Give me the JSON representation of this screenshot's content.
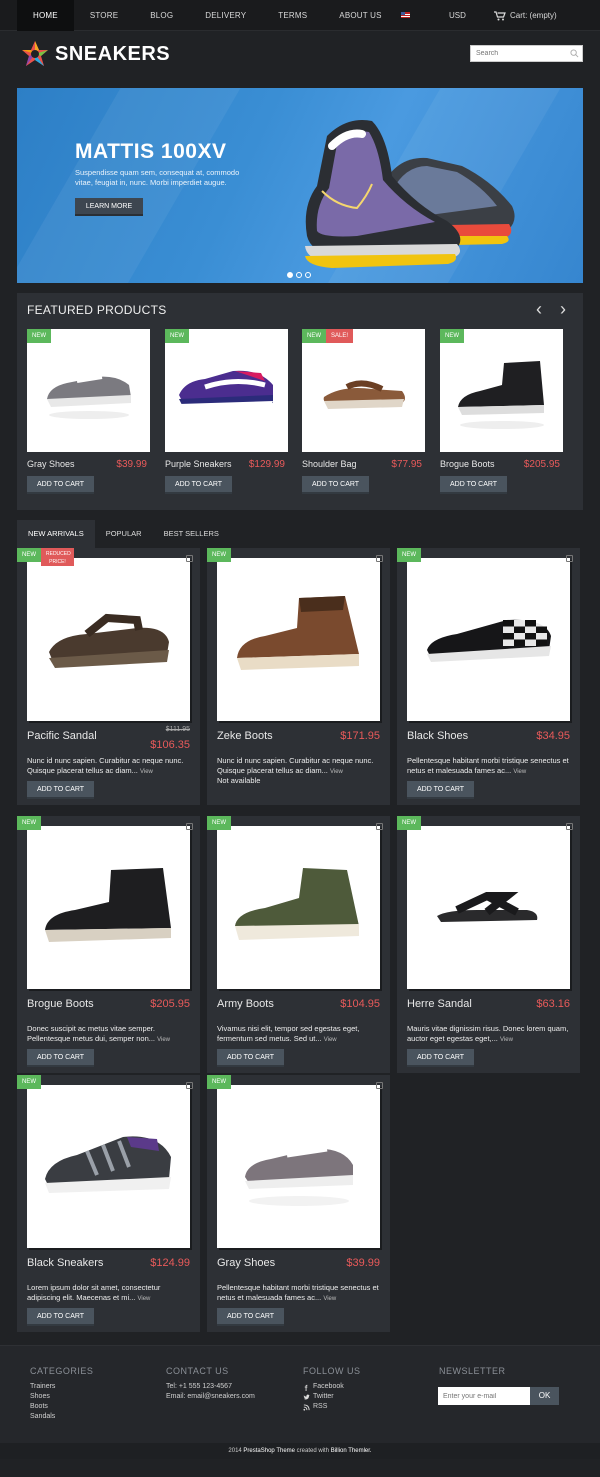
{
  "nav": {
    "items": [
      "HOME",
      "STORE",
      "BLOG",
      "DELIVERY",
      "TERMS",
      "ABOUT US"
    ],
    "currency": "USD",
    "cart": "Cart: (empty)"
  },
  "header": {
    "logo": "SNEAKERS",
    "search_placeholder": "Search"
  },
  "hero": {
    "title": "MATTIS 100XV",
    "text": "Suspendisse quam sem, consequat at, commodo vitae, feugiat in, nunc. Morbi imperdiet augue.",
    "button": "LEARN MORE"
  },
  "featured": {
    "title": "FEATURED PRODUCTS",
    "prev": "‹",
    "next": "›",
    "products": [
      {
        "name": "Gray Shoes",
        "price": "$39.99",
        "badge": "NEW",
        "sale": ""
      },
      {
        "name": "Purple Sneakers",
        "price": "$129.99",
        "badge": "NEW",
        "sale": ""
      },
      {
        "name": "Shoulder Bag",
        "price": "$77.95",
        "badge": "NEW",
        "sale": "SALE!"
      },
      {
        "name": "Brogue Boots",
        "price": "$205.95",
        "badge": "NEW",
        "sale": ""
      }
    ],
    "add_to_cart": "ADD TO CART"
  },
  "tabs": [
    "NEW ARRIVALS",
    "POPULAR",
    "BEST SELLERS"
  ],
  "grid": {
    "add_to_cart": "ADD TO CART",
    "view": "View",
    "products": [
      {
        "name": "Pacific Sandal",
        "price": "$106.35",
        "old_price": "$111.95",
        "badge": "NEW",
        "sale": "REDUCED PRICE!",
        "desc": "Nunc id nunc sapien. Curabitur ac neque nunc. Quisque placerat tellus ac diam...",
        "availability": ""
      },
      {
        "name": "Zeke Boots",
        "price": "$171.95",
        "old_price": "",
        "badge": "NEW",
        "sale": "",
        "desc": "Nunc id nunc sapien. Curabitur ac neque nunc. Quisque placerat tellus ac diam...",
        "availability": "Not available"
      },
      {
        "name": "Black Shoes",
        "price": "$34.95",
        "old_price": "",
        "badge": "NEW",
        "sale": "",
        "desc": "Pellentesque habitant morbi tristique senectus et netus et malesuada fames ac...",
        "availability": ""
      },
      {
        "name": "Brogue Boots",
        "price": "$205.95",
        "old_price": "",
        "badge": "NEW",
        "sale": "",
        "desc": "Donec suscipit ac metus vitae semper. Pellentesque metus dui, semper non...",
        "availability": ""
      },
      {
        "name": "Army Boots",
        "price": "$104.95",
        "old_price": "",
        "badge": "NEW",
        "sale": "",
        "desc": "Vivamus nisi elit, tempor sed egestas eget, fermentum sed metus. Sed ut...",
        "availability": ""
      },
      {
        "name": "Herre Sandal",
        "price": "$63.16",
        "old_price": "",
        "badge": "NEW",
        "sale": "",
        "desc": "Mauris vitae dignissim risus. Donec lorem quam, auctor eget egestas eget,...",
        "availability": ""
      },
      {
        "name": "Black Sneakers",
        "price": "$124.99",
        "old_price": "",
        "badge": "NEW",
        "sale": "",
        "desc": "Lorem ipsum dolor sit amet, consectetur adipiscing elit. Maecenas et mi...",
        "availability": ""
      },
      {
        "name": "Gray Shoes",
        "price": "$39.99",
        "old_price": "",
        "badge": "NEW",
        "sale": "",
        "desc": "Pellentesque habitant morbi tristique senectus et netus et malesuada fames ac...",
        "availability": ""
      }
    ]
  },
  "footer": {
    "categories": {
      "title": "CATEGORIES",
      "items": [
        "Trainers",
        "Shoes",
        "Boots",
        "Sandals"
      ]
    },
    "contact": {
      "title": "CONTACT US",
      "tel": "Tel: +1 555 123-4567",
      "email": "Email: email@sneakers.com"
    },
    "follow": {
      "title": "FOLLOW US",
      "items": [
        "Facebook",
        "Twitter",
        "RSS"
      ]
    },
    "newsletter": {
      "title": "NEWSLETTER",
      "placeholder": "Enter your e-mail",
      "button": "OK"
    },
    "copyright_prefix": "2014 ",
    "copyright_theme": "PrestaShop Theme",
    "copyright_mid": " created with ",
    "copyright_author": "Billion Themler."
  }
}
